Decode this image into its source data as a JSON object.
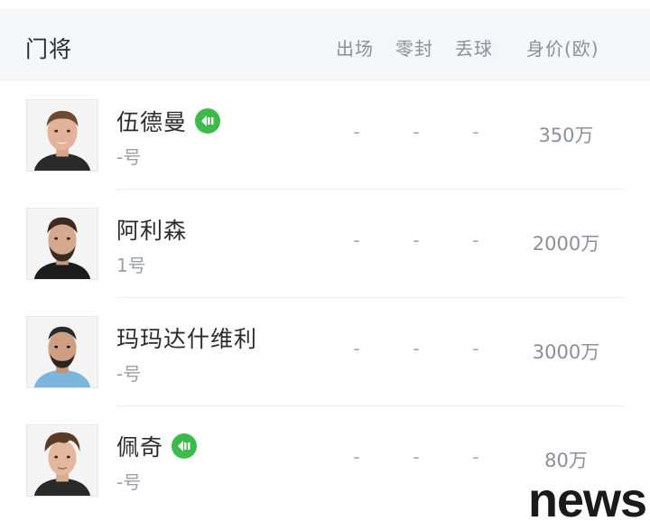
{
  "header": {
    "title": "门将",
    "col_apps": "出场",
    "col_clean": "零封",
    "col_conceded": "丢球",
    "col_value": "身价(欧)"
  },
  "players": [
    {
      "name": "伍德曼",
      "number": "-号",
      "apps": "-",
      "clean": "-",
      "conceded": "-",
      "value": "350万",
      "badge": true
    },
    {
      "name": "阿利森",
      "number": "1号",
      "apps": "-",
      "clean": "-",
      "conceded": "-",
      "value": "2000万",
      "badge": false
    },
    {
      "name": "玛玛达什维利",
      "number": "-号",
      "apps": "-",
      "clean": "-",
      "conceded": "-",
      "value": "3000万",
      "badge": false
    },
    {
      "name": "佩奇",
      "number": "-号",
      "apps": "-",
      "clean": "-",
      "conceded": "-",
      "value": "80万",
      "badge": true
    }
  ],
  "icons": {
    "badge": "new-signing-arrow-icon",
    "avatar": "player-photo"
  },
  "colors": {
    "header_bg": "#f5f6f8",
    "badge": "#3dbb4a",
    "muted_text": "#8a8f99"
  },
  "watermark": "news"
}
